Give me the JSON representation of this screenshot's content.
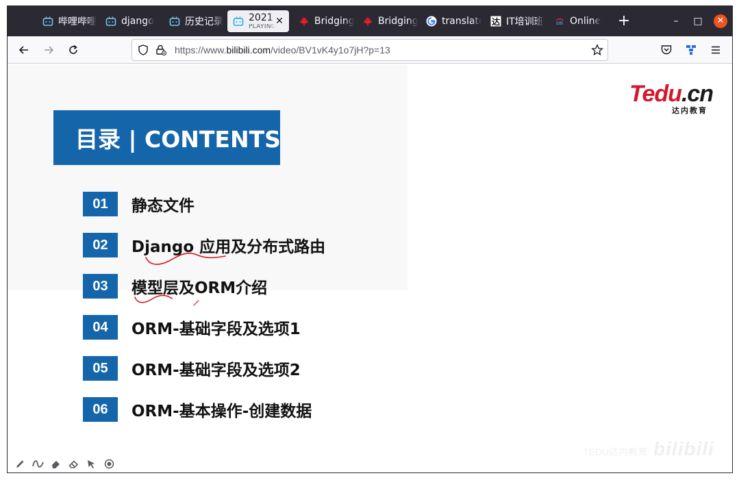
{
  "browser": {
    "tabs": [
      {
        "label": "哔哩哔哩",
        "icon": "bilibili-tv-icon"
      },
      {
        "label": "django",
        "icon": "bilibili-tv-icon"
      },
      {
        "label": "历史记录",
        "icon": "bilibili-tv-icon"
      },
      {
        "label": "2021",
        "sublabel": "PLAYING",
        "icon": "bilibili-tv-icon",
        "active": true
      },
      {
        "label": "Bridging",
        "icon": "maple-leaf-icon"
      },
      {
        "label": "Bridging",
        "icon": "maple-leaf-icon"
      },
      {
        "label": "translate",
        "icon": "google-icon"
      },
      {
        "label": "IT培训班",
        "icon": "tedu-icon"
      },
      {
        "label": "Online",
        "icon": "citi-icon"
      }
    ],
    "new_tab": "+",
    "window_controls": {
      "minimize": "–",
      "maximize": "□",
      "close": "✕"
    },
    "url": {
      "prefix": "https://www.",
      "domain": "bilibili.com",
      "path": "/video/BV1vK4y1o7jH?p=13"
    }
  },
  "slide": {
    "logo": {
      "brand_red": "Tedu",
      "brand_black": ".cn",
      "tagline": "达内教育"
    },
    "title": "目录 | CONTENTS",
    "items": [
      {
        "num": "01",
        "label": "静态文件"
      },
      {
        "num": "02",
        "label": "Django 应用及分布式路由"
      },
      {
        "num": "03",
        "label": "模型层及ORM介绍"
      },
      {
        "num": "04",
        "label": "ORM-基础字段及选项1"
      },
      {
        "num": "05",
        "label": "ORM-基础字段及选项2"
      },
      {
        "num": "06",
        "label": "ORM-基本操作-创建数据"
      }
    ],
    "accent_color": "#1565ab",
    "annotation_color": "#d4161b"
  },
  "player": {
    "tools": [
      "pen-icon",
      "curve-icon",
      "highlighter-icon",
      "eraser-icon",
      "pointer-icon",
      "record-icon"
    ],
    "watermark": {
      "text": "bilibili",
      "small": "TEDU达内教育"
    }
  }
}
